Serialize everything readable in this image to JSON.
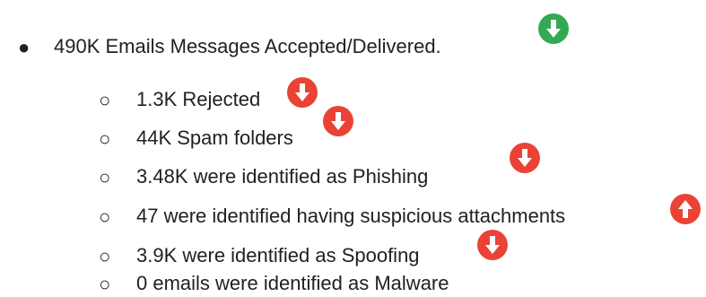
{
  "list": {
    "main": {
      "bullet": "●",
      "text": "490K Emails Messages Accepted/Delivered.",
      "trend": "down",
      "trend_color": "#34a853",
      "trend_icon": "arrow-down-circle-icon"
    },
    "sub_bullet": "○",
    "items": [
      {
        "text": "1.3K Rejected",
        "trend": "down",
        "trend_color": "#ea4335",
        "trend_icon": "arrow-down-circle-icon"
      },
      {
        "text": "44K Spam folders",
        "trend": "down",
        "trend_color": "#ea4335",
        "trend_icon": "arrow-down-circle-icon"
      },
      {
        "text": "3.48K were identified as Phishing",
        "trend": "down",
        "trend_color": "#ea4335",
        "trend_icon": "arrow-down-circle-icon"
      },
      {
        "text": "47 were identified having suspicious attachments",
        "trend": "up",
        "trend_color": "#ea4335",
        "trend_icon": "arrow-up-circle-icon"
      },
      {
        "text": "3.9K were identified as Spoofing",
        "trend": "down",
        "trend_color": "#ea4335",
        "trend_icon": "arrow-down-circle-icon"
      },
      {
        "text": "0 emails were identified as Malware",
        "trend": null,
        "trend_color": null,
        "trend_icon": null
      }
    ]
  }
}
